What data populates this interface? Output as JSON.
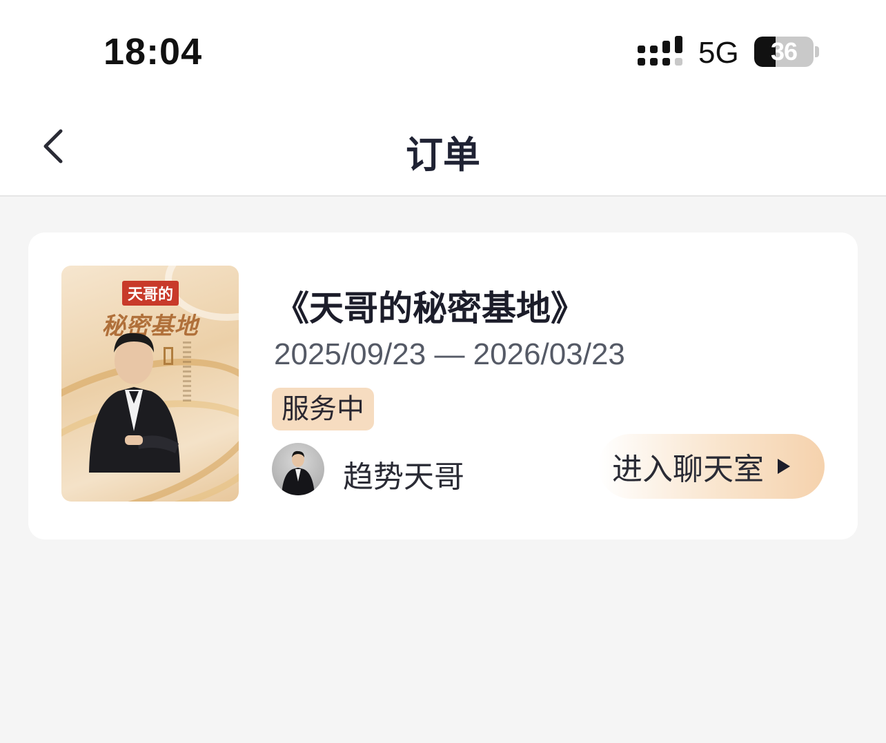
{
  "status_bar": {
    "time": "18:04",
    "network": "5G",
    "battery_percent": 36,
    "battery_label": "36",
    "signal_icon": "signal-bars-icon"
  },
  "nav": {
    "title": "订单",
    "back_icon": "chevron-left-icon"
  },
  "order": {
    "poster": {
      "badge": "天哥的",
      "title": "秘密基地"
    },
    "title": "《天哥的秘密基地》",
    "date_range": "2025/09/23 — 2026/03/23",
    "status": "服务中",
    "host_name": "趋势天哥",
    "chat_button_label": "进入聊天室",
    "chat_icon": "play-triangle-icon"
  },
  "colors": {
    "page_background": "#f5f5f5",
    "status_badge_bg": "#f6dcc0",
    "chat_button_accent": "#f5d2ad"
  }
}
